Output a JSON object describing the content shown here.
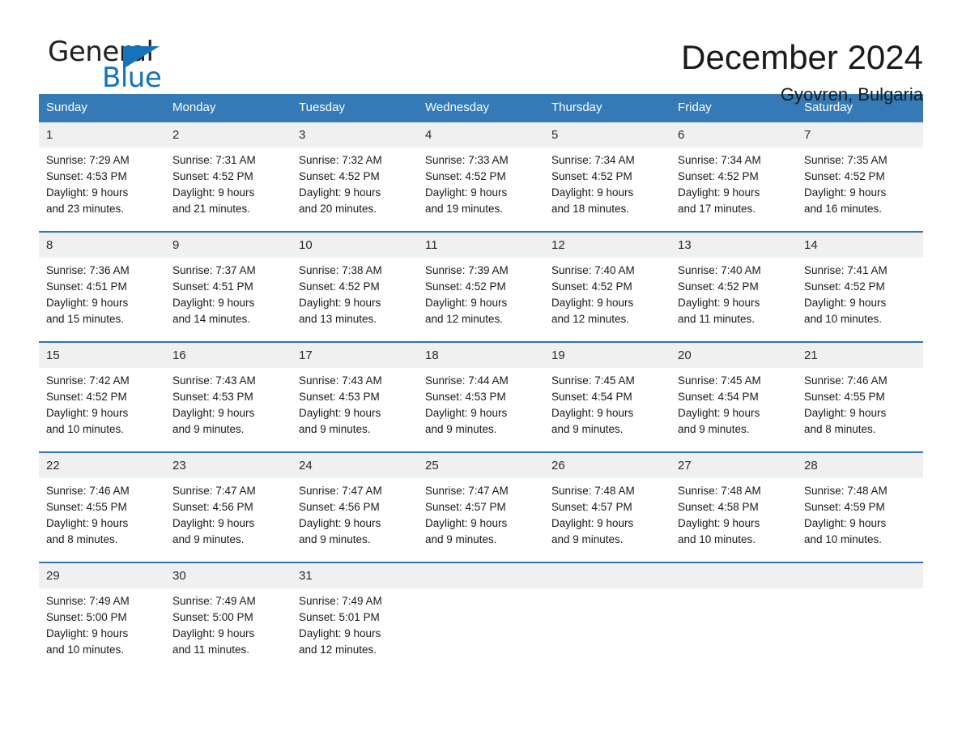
{
  "brand": {
    "name_part1": "General",
    "name_part2": "Blue",
    "accent_color": "#1573bb"
  },
  "header": {
    "title": "December 2024",
    "subtitle": "Gyovren, Bulgaria"
  },
  "theme": {
    "header_row_bg": "#337ab7",
    "row_divider": "#2f74b5",
    "daynum_bg": "#f0f0f0"
  },
  "weekday_headers": [
    "Sunday",
    "Monday",
    "Tuesday",
    "Wednesday",
    "Thursday",
    "Friday",
    "Saturday"
  ],
  "weeks": [
    {
      "days": [
        {
          "day": "1",
          "sunrise": "Sunrise: 7:29 AM",
          "sunset": "Sunset: 4:53 PM",
          "daylight_line1": "Daylight: 9 hours",
          "daylight_line2": "and 23 minutes."
        },
        {
          "day": "2",
          "sunrise": "Sunrise: 7:31 AM",
          "sunset": "Sunset: 4:52 PM",
          "daylight_line1": "Daylight: 9 hours",
          "daylight_line2": "and 21 minutes."
        },
        {
          "day": "3",
          "sunrise": "Sunrise: 7:32 AM",
          "sunset": "Sunset: 4:52 PM",
          "daylight_line1": "Daylight: 9 hours",
          "daylight_line2": "and 20 minutes."
        },
        {
          "day": "4",
          "sunrise": "Sunrise: 7:33 AM",
          "sunset": "Sunset: 4:52 PM",
          "daylight_line1": "Daylight: 9 hours",
          "daylight_line2": "and 19 minutes."
        },
        {
          "day": "5",
          "sunrise": "Sunrise: 7:34 AM",
          "sunset": "Sunset: 4:52 PM",
          "daylight_line1": "Daylight: 9 hours",
          "daylight_line2": "and 18 minutes."
        },
        {
          "day": "6",
          "sunrise": "Sunrise: 7:34 AM",
          "sunset": "Sunset: 4:52 PM",
          "daylight_line1": "Daylight: 9 hours",
          "daylight_line2": "and 17 minutes."
        },
        {
          "day": "7",
          "sunrise": "Sunrise: 7:35 AM",
          "sunset": "Sunset: 4:52 PM",
          "daylight_line1": "Daylight: 9 hours",
          "daylight_line2": "and 16 minutes."
        }
      ]
    },
    {
      "days": [
        {
          "day": "8",
          "sunrise": "Sunrise: 7:36 AM",
          "sunset": "Sunset: 4:51 PM",
          "daylight_line1": "Daylight: 9 hours",
          "daylight_line2": "and 15 minutes."
        },
        {
          "day": "9",
          "sunrise": "Sunrise: 7:37 AM",
          "sunset": "Sunset: 4:51 PM",
          "daylight_line1": "Daylight: 9 hours",
          "daylight_line2": "and 14 minutes."
        },
        {
          "day": "10",
          "sunrise": "Sunrise: 7:38 AM",
          "sunset": "Sunset: 4:52 PM",
          "daylight_line1": "Daylight: 9 hours",
          "daylight_line2": "and 13 minutes."
        },
        {
          "day": "11",
          "sunrise": "Sunrise: 7:39 AM",
          "sunset": "Sunset: 4:52 PM",
          "daylight_line1": "Daylight: 9 hours",
          "daylight_line2": "and 12 minutes."
        },
        {
          "day": "12",
          "sunrise": "Sunrise: 7:40 AM",
          "sunset": "Sunset: 4:52 PM",
          "daylight_line1": "Daylight: 9 hours",
          "daylight_line2": "and 12 minutes."
        },
        {
          "day": "13",
          "sunrise": "Sunrise: 7:40 AM",
          "sunset": "Sunset: 4:52 PM",
          "daylight_line1": "Daylight: 9 hours",
          "daylight_line2": "and 11 minutes."
        },
        {
          "day": "14",
          "sunrise": "Sunrise: 7:41 AM",
          "sunset": "Sunset: 4:52 PM",
          "daylight_line1": "Daylight: 9 hours",
          "daylight_line2": "and 10 minutes."
        }
      ]
    },
    {
      "days": [
        {
          "day": "15",
          "sunrise": "Sunrise: 7:42 AM",
          "sunset": "Sunset: 4:52 PM",
          "daylight_line1": "Daylight: 9 hours",
          "daylight_line2": "and 10 minutes."
        },
        {
          "day": "16",
          "sunrise": "Sunrise: 7:43 AM",
          "sunset": "Sunset: 4:53 PM",
          "daylight_line1": "Daylight: 9 hours",
          "daylight_line2": "and 9 minutes."
        },
        {
          "day": "17",
          "sunrise": "Sunrise: 7:43 AM",
          "sunset": "Sunset: 4:53 PM",
          "daylight_line1": "Daylight: 9 hours",
          "daylight_line2": "and 9 minutes."
        },
        {
          "day": "18",
          "sunrise": "Sunrise: 7:44 AM",
          "sunset": "Sunset: 4:53 PM",
          "daylight_line1": "Daylight: 9 hours",
          "daylight_line2": "and 9 minutes."
        },
        {
          "day": "19",
          "sunrise": "Sunrise: 7:45 AM",
          "sunset": "Sunset: 4:54 PM",
          "daylight_line1": "Daylight: 9 hours",
          "daylight_line2": "and 9 minutes."
        },
        {
          "day": "20",
          "sunrise": "Sunrise: 7:45 AM",
          "sunset": "Sunset: 4:54 PM",
          "daylight_line1": "Daylight: 9 hours",
          "daylight_line2": "and 9 minutes."
        },
        {
          "day": "21",
          "sunrise": "Sunrise: 7:46 AM",
          "sunset": "Sunset: 4:55 PM",
          "daylight_line1": "Daylight: 9 hours",
          "daylight_line2": "and 8 minutes."
        }
      ]
    },
    {
      "days": [
        {
          "day": "22",
          "sunrise": "Sunrise: 7:46 AM",
          "sunset": "Sunset: 4:55 PM",
          "daylight_line1": "Daylight: 9 hours",
          "daylight_line2": "and 8 minutes."
        },
        {
          "day": "23",
          "sunrise": "Sunrise: 7:47 AM",
          "sunset": "Sunset: 4:56 PM",
          "daylight_line1": "Daylight: 9 hours",
          "daylight_line2": "and 9 minutes."
        },
        {
          "day": "24",
          "sunrise": "Sunrise: 7:47 AM",
          "sunset": "Sunset: 4:56 PM",
          "daylight_line1": "Daylight: 9 hours",
          "daylight_line2": "and 9 minutes."
        },
        {
          "day": "25",
          "sunrise": "Sunrise: 7:47 AM",
          "sunset": "Sunset: 4:57 PM",
          "daylight_line1": "Daylight: 9 hours",
          "daylight_line2": "and 9 minutes."
        },
        {
          "day": "26",
          "sunrise": "Sunrise: 7:48 AM",
          "sunset": "Sunset: 4:57 PM",
          "daylight_line1": "Daylight: 9 hours",
          "daylight_line2": "and 9 minutes."
        },
        {
          "day": "27",
          "sunrise": "Sunrise: 7:48 AM",
          "sunset": "Sunset: 4:58 PM",
          "daylight_line1": "Daylight: 9 hours",
          "daylight_line2": "and 10 minutes."
        },
        {
          "day": "28",
          "sunrise": "Sunrise: 7:48 AM",
          "sunset": "Sunset: 4:59 PM",
          "daylight_line1": "Daylight: 9 hours",
          "daylight_line2": "and 10 minutes."
        }
      ]
    },
    {
      "days": [
        {
          "day": "29",
          "sunrise": "Sunrise: 7:49 AM",
          "sunset": "Sunset: 5:00 PM",
          "daylight_line1": "Daylight: 9 hours",
          "daylight_line2": "and 10 minutes."
        },
        {
          "day": "30",
          "sunrise": "Sunrise: 7:49 AM",
          "sunset": "Sunset: 5:00 PM",
          "daylight_line1": "Daylight: 9 hours",
          "daylight_line2": "and 11 minutes."
        },
        {
          "day": "31",
          "sunrise": "Sunrise: 7:49 AM",
          "sunset": "Sunset: 5:01 PM",
          "daylight_line1": "Daylight: 9 hours",
          "daylight_line2": "and 12 minutes."
        },
        {
          "day": "",
          "sunrise": "",
          "sunset": "",
          "daylight_line1": "",
          "daylight_line2": ""
        },
        {
          "day": "",
          "sunrise": "",
          "sunset": "",
          "daylight_line1": "",
          "daylight_line2": ""
        },
        {
          "day": "",
          "sunrise": "",
          "sunset": "",
          "daylight_line1": "",
          "daylight_line2": ""
        },
        {
          "day": "",
          "sunrise": "",
          "sunset": "",
          "daylight_line1": "",
          "daylight_line2": ""
        }
      ]
    }
  ]
}
